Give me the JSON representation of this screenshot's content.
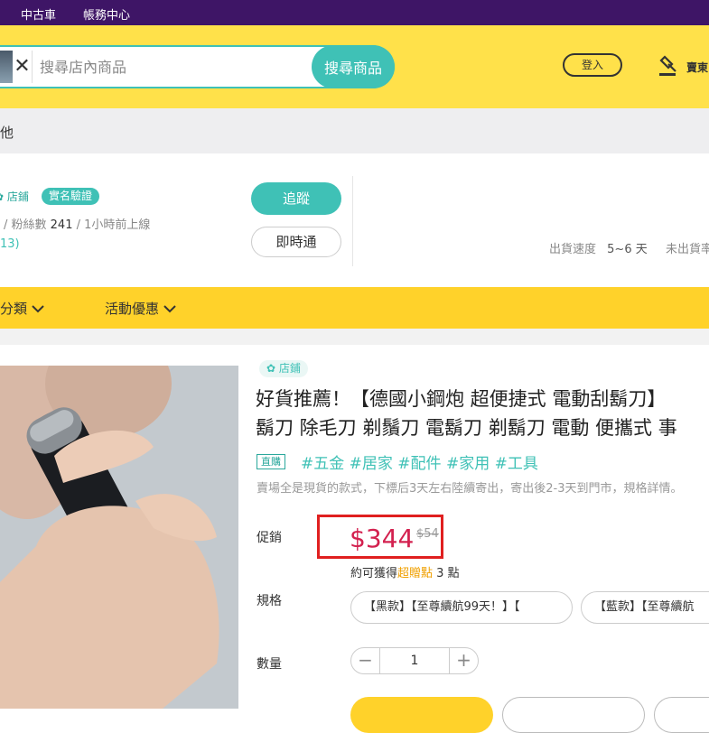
{
  "topbar": {
    "used_car": "中古車",
    "account_center": "帳務中心"
  },
  "header": {
    "search_placeholder": "搜尋店內商品",
    "search_button": "搜尋商品",
    "login_button": "登入",
    "seller_label": "賣東"
  },
  "category_crumb": "他",
  "shop": {
    "store_badge": "✿ 店鋪",
    "verified_badge": "實名驗證",
    "stats_prefix": "/ 粉絲數",
    "fans": "241",
    "stats_suffix": "/ 1小時前上線",
    "rating": "13)",
    "follow_button": "追蹤",
    "chat_button": "即時通",
    "ship_label": "出貨速度",
    "ship_value": "5~6 天",
    "unshipped_label": "未出貨率"
  },
  "catbar": {
    "categories": "分類",
    "promotions": "活動優惠"
  },
  "product": {
    "store_tag": "✿ 店鋪",
    "title_line1": "好貨推薦！【德國小鋼炮 超便捷式 電動刮鬍刀】",
    "title_line2": "鬍刀 除毛刀 剃鬚刀 電鬍刀 剃鬍刀 電動 便攜式 事",
    "direct_badge": "直購",
    "tags": "#五金 #居家 #配件 #家用 #工具",
    "description": "賣場全是現貨的款式，下標后3天左右陸續寄出，寄出後2-3天到門市，規格詳情。",
    "promo_label": "促銷",
    "price": "$344",
    "old_price": "$54",
    "points_prefix": "約可獲得",
    "points_link": "超贈點",
    "points_suffix": "3 點",
    "spec_label": "規格",
    "specs": [
      "【黑款】【至尊續航99天！】【",
      "【藍款】【至尊續航"
    ],
    "qty_label": "數量",
    "qty_minus": "−",
    "qty_value": "1",
    "qty_plus": "+"
  },
  "colors": {
    "topbar": "#3e1566",
    "header": "#ffe14a",
    "teal": "#3fc1b6",
    "price": "#d3214f",
    "highlight": "#e02020"
  }
}
